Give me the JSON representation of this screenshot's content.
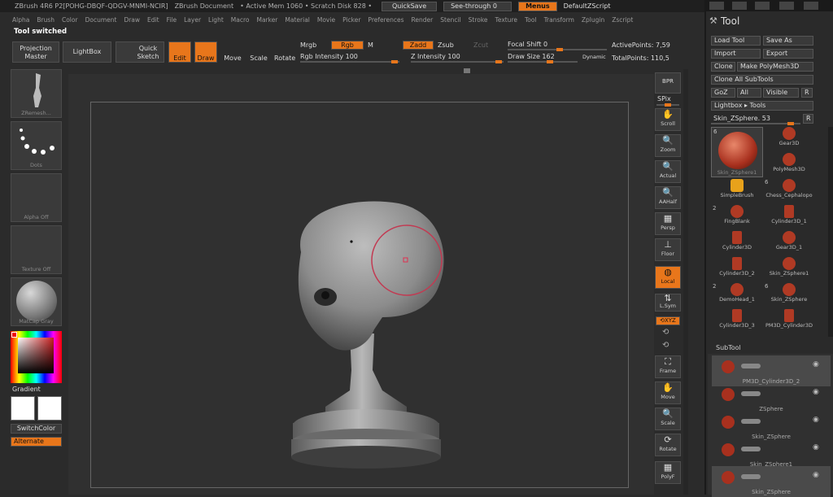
{
  "titlebar": {
    "app": "ZBrush 4R6 P2[POHG-DBQF-QDGV-MNMI-NCIR]",
    "doc": "ZBrush Document",
    "mem": "• Active Mem 1060 • Scratch Disk 828 •",
    "quicksave": "QuickSave",
    "seethrough": "See-through  0",
    "menus": "Menus",
    "defscript": "DefaultZScript"
  },
  "menubar": [
    "Alpha",
    "Brush",
    "Color",
    "Document",
    "Draw",
    "Edit",
    "File",
    "Layer",
    "Light",
    "Macro",
    "Marker",
    "Material",
    "Movie",
    "Picker",
    "Preferences",
    "Render",
    "Stencil",
    "Stroke",
    "Texture",
    "Tool",
    "Transform",
    "Zplugin",
    "Zscript"
  ],
  "notice": "Tool switched",
  "toolbar": {
    "projection": "Projection Master",
    "lightbox": "LightBox",
    "quicksketch": "Quick Sketch",
    "edit": "Edit",
    "draw": "Draw",
    "move": "Move",
    "scale": "Scale",
    "rotate": "Rotate",
    "mrgb": "Mrgb",
    "rgb": "Rgb",
    "m": "M",
    "rgb_intensity": "Rgb Intensity 100",
    "zadd": "Zadd",
    "zsub": "Zsub",
    "zcut": "Zcut",
    "z_intensity": "Z Intensity 100",
    "focal": "Focal Shift 0",
    "drawsize": "Draw Size 162",
    "dynamic": "Dynamic",
    "active_points": "ActivePoints: 7,59",
    "total_points": "TotalPoints: 110,5"
  },
  "left": {
    "brush_cap": "ZRemesh...",
    "stroke_cap": "Dots",
    "alpha_cap": "Alpha Off",
    "texture_cap": "Texture Off",
    "material_cap": "MatCap Gray",
    "gradient": "Gradient",
    "switchcolor": "SwitchColor",
    "alternate": "Alternate"
  },
  "right": {
    "bpr": "BPR",
    "spix": "SPix",
    "scroll": "Scroll",
    "zoom": "Zoom",
    "actual": "Actual",
    "aahalf": "AAHalf",
    "persp": "Persp",
    "floor": "Floor",
    "local": "Local",
    "lsym": "L.Sym",
    "xyz": "⟲XYZ",
    "frame": "Frame",
    "move": "Move",
    "scale": "Scale",
    "rotate": "Rotate",
    "polyf": "PolyF"
  },
  "tool": {
    "title": "Tool",
    "load": "Load Tool",
    "saveas": "Save As",
    "import": "Import",
    "export": "Export",
    "clone": "Clone",
    "makepoly": "Make PolyMesh3D",
    "cloneall": "Clone All SubTools",
    "goz": "GoZ",
    "all": "All",
    "visible": "Visible",
    "r": "R",
    "lightbox_tools": "Lightbox ▸ Tools",
    "current": "Skin_ZSphere. 53",
    "current_r": "R",
    "badge_main": "6",
    "main_cap": "Skin_ZSphere1",
    "items": [
      {
        "name": "Gear3D",
        "badge": ""
      },
      {
        "name": "PolyMesh3D",
        "badge": ""
      },
      {
        "name": "SimpleBrush",
        "badge": ""
      },
      {
        "name": "Chess_Cephalopo",
        "badge": "6"
      },
      {
        "name": "FingBlank",
        "badge": "2"
      },
      {
        "name": "Cylinder3D_1",
        "badge": ""
      },
      {
        "name": "Cylinder3D",
        "badge": ""
      },
      {
        "name": "Gear3D_1",
        "badge": ""
      },
      {
        "name": "Cylinder3D_2",
        "badge": ""
      },
      {
        "name": "Skin_ZSphere1",
        "badge": ""
      },
      {
        "name": "DemoHead_1",
        "badge": "2"
      },
      {
        "name": "Skin_ZSphere",
        "badge": "6"
      },
      {
        "name": "Cylinder3D_3",
        "badge": ""
      },
      {
        "name": "PM3D_Cylinder3D",
        "badge": ""
      }
    ],
    "colors": {
      "accent": "#e8761b",
      "tool_red": "#b03a24"
    }
  },
  "subtool": {
    "title": "SubTool",
    "rows": [
      "PM3D_Cylinder3D_2",
      "ZSphere",
      "Skin_ZSphere",
      "Skin_ZSphere1",
      "Skin_ZSphere"
    ]
  }
}
